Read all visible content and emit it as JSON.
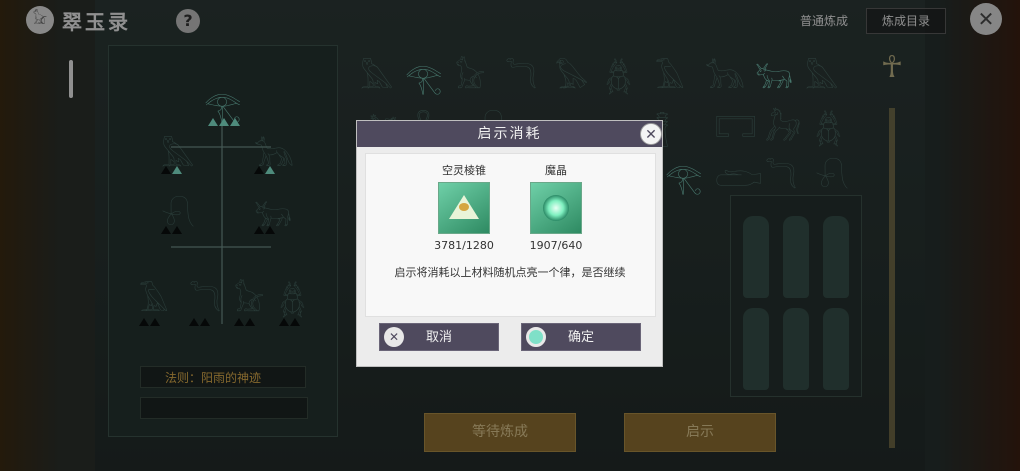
{
  "header": {
    "app_title": "翠玉录",
    "logo_icon": "sphinx-logo-icon",
    "help_label": "?",
    "mode_label": "普通炼成",
    "catalog_button": "炼成目录",
    "close_icon": "close-icon"
  },
  "left_panel": {
    "rule_label": "法则：阳雨的神迹"
  },
  "bottom": {
    "wait_button": "等待炼成",
    "reveal_button": "启示"
  },
  "modal": {
    "title": "启示消耗",
    "items": [
      {
        "name": "空灵棱锥",
        "icon": "pyramid-crystal-icon",
        "count": "3781/1280"
      },
      {
        "name": "魔晶",
        "icon": "magic-crystal-icon",
        "count": "1907/640"
      }
    ],
    "description": "启示将消耗以上材料随机点亮一个律，是否继续",
    "cancel_label": "取消",
    "confirm_label": "确定"
  },
  "colors": {
    "modal_header": "#4f4a5e",
    "accent_teal": "#7fe0c8",
    "gold_button": "#8c6d31",
    "rule_text": "#d7a94a"
  }
}
